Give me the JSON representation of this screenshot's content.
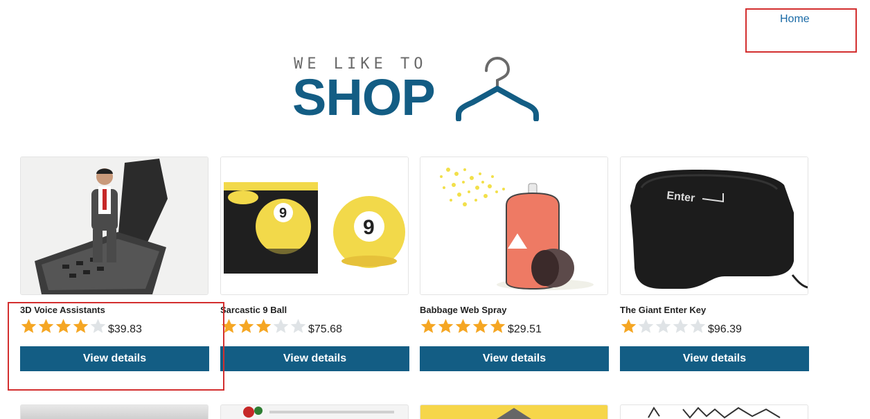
{
  "nav": {
    "home_label": "Home"
  },
  "logo": {
    "top_text": "WE LIKE TO",
    "main_text": "SHOP",
    "icon": "hanger-icon"
  },
  "colors": {
    "brand": "#135d84",
    "star": "#f5a623",
    "star_empty": "#dfe3e6",
    "highlight": "#d32f2f"
  },
  "products": [
    {
      "name": "3D Voice Assistants",
      "rating": 4,
      "price": "$39.83",
      "button": "View details",
      "image": "voice-assistant-figure-image"
    },
    {
      "name": "Sarcastic 9 Ball",
      "rating": 3,
      "price": "$75.68",
      "button": "View details",
      "image": "sarcastic-9-ball-image"
    },
    {
      "name": "Babbage Web Spray",
      "rating": 5,
      "price": "$29.51",
      "button": "View details",
      "image": "spray-can-image"
    },
    {
      "name": "The Giant Enter Key",
      "rating": 1,
      "price": "$96.39",
      "button": "View details",
      "image": "giant-enter-key-image"
    }
  ]
}
